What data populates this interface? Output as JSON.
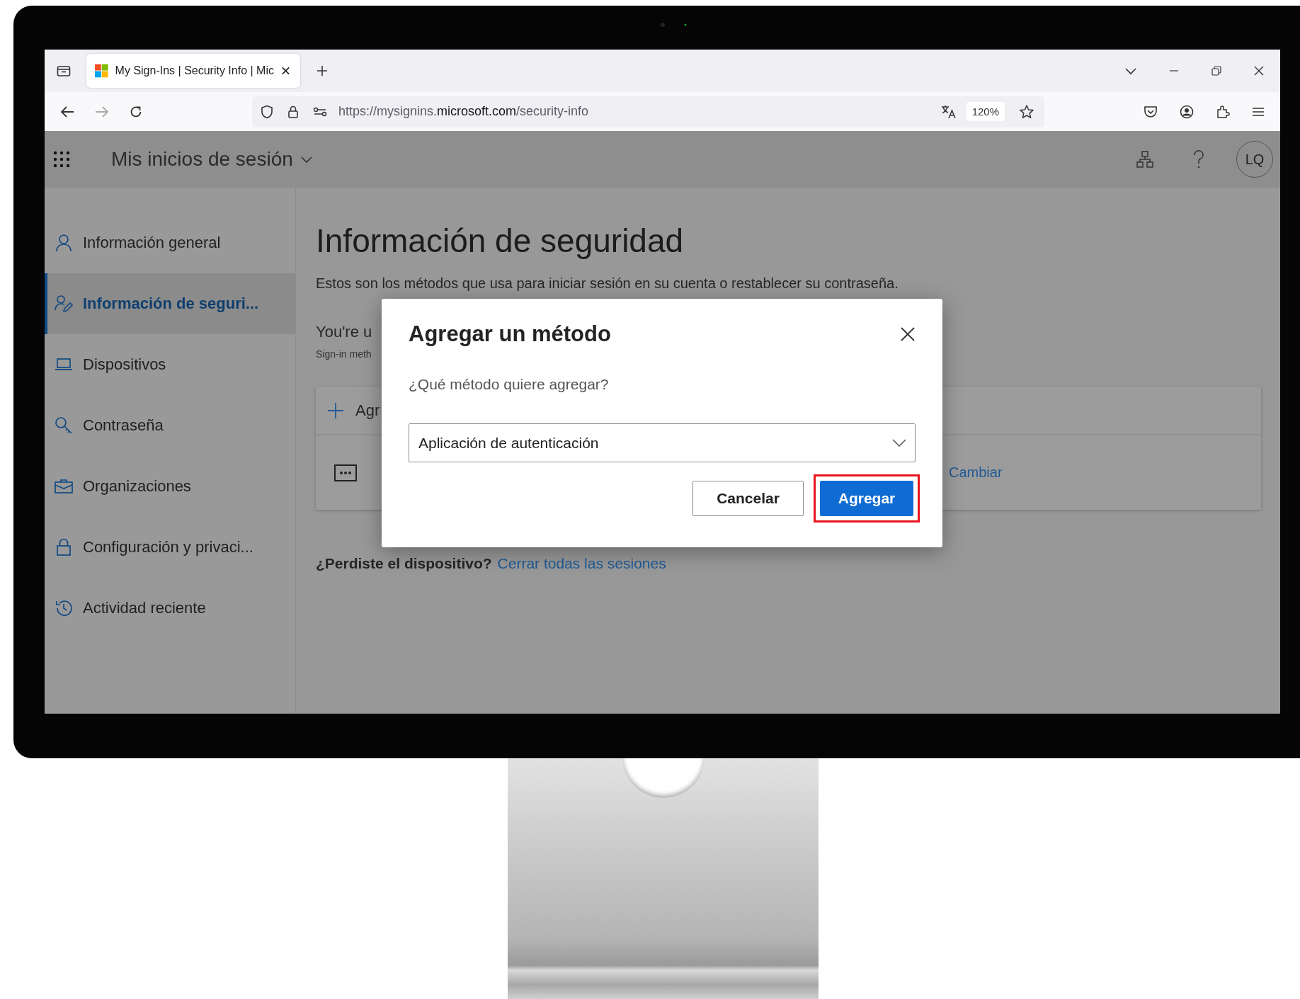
{
  "browser": {
    "tab": {
      "title": "My Sign-Ins | Security Info | Mic"
    },
    "url": "https://mysignins.**microsoft.com**/security-info",
    "zoom": "120%"
  },
  "header": {
    "title": "Mis inicios de sesión",
    "avatar": "LQ"
  },
  "sidebar": {
    "items": [
      {
        "label": "Información general",
        "selected": false
      },
      {
        "label": "Información de seguri...",
        "selected": true
      },
      {
        "label": "Dispositivos",
        "selected": false
      },
      {
        "label": "Contraseña",
        "selected": false
      },
      {
        "label": "Organizaciones",
        "selected": false
      },
      {
        "label": "Configuración y privaci...",
        "selected": false
      },
      {
        "label": "Actividad reciente",
        "selected": false
      }
    ]
  },
  "main": {
    "title": "Información de seguridad",
    "description": "Estos son los métodos que usa para iniciar sesión en su cuenta o restablecer su contraseña.",
    "default_heading": "You're u",
    "default_note": "Sign-in meth",
    "add_method": "Agr",
    "change_link": "Cambiar",
    "lost_device": {
      "text": "¿Perdiste el dispositivo?",
      "link": "Cerrar todas las sesiones"
    }
  },
  "dialog": {
    "title": "Agregar un método",
    "question": "¿Qué método quiere agregar?",
    "method_select": {
      "value": "Aplicación de autenticación"
    },
    "buttons": [
      {
        "label": "Cancelar",
        "kind": "secondary",
        "highlighted": false
      },
      {
        "label": "Agregar",
        "kind": "primary",
        "highlighted": true
      }
    ]
  }
}
